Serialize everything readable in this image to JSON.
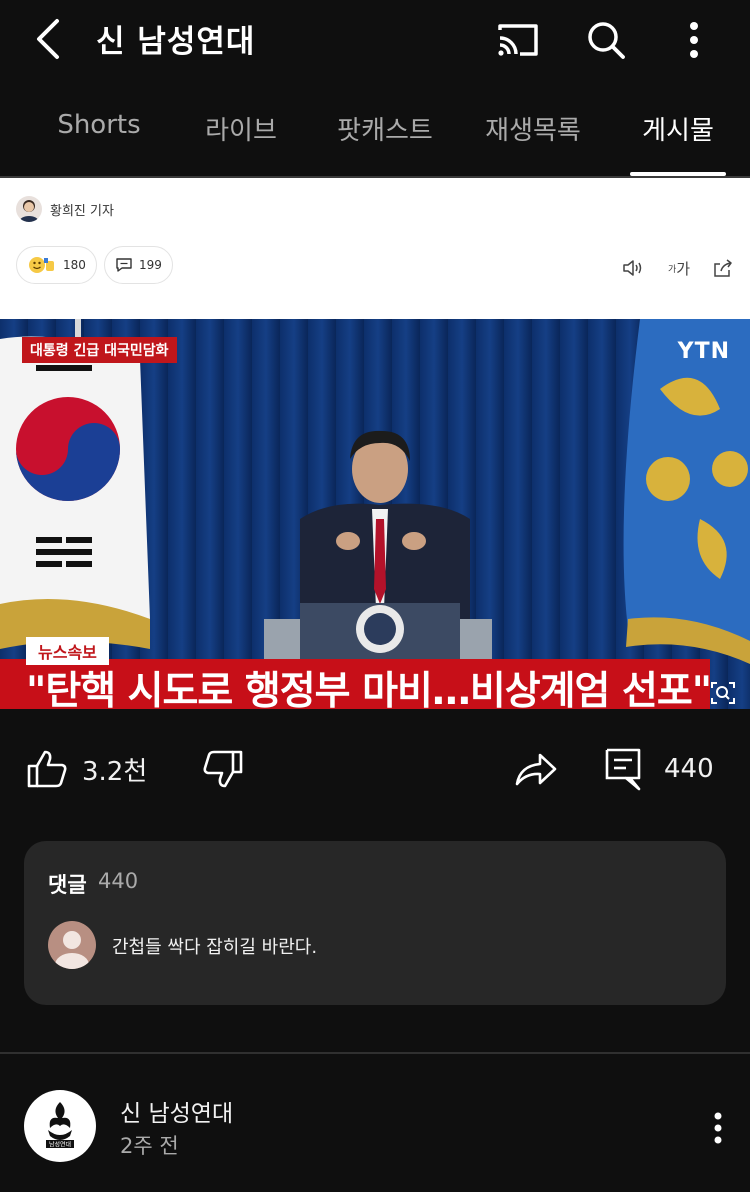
{
  "header": {
    "title": "신 남성연대",
    "back_icon": "chevron-left-icon",
    "cast_icon": "cast-icon",
    "search_icon": "search-icon",
    "menu_icon": "more-vertical-icon"
  },
  "tabs": [
    {
      "label": "Shorts",
      "active": false
    },
    {
      "label": "라이브",
      "active": false
    },
    {
      "label": "팟캐스트",
      "active": false
    },
    {
      "label": "재생목록",
      "active": false
    },
    {
      "label": "게시물",
      "active": true
    }
  ],
  "article": {
    "reporter": "황희진 기자",
    "reactions_count": "180",
    "comments_count": "199",
    "font_size_label": "가"
  },
  "video": {
    "top_caption": "대통령 긴급 대국민담화",
    "broadcaster": "YTN",
    "news_tag": "뉴스속보",
    "headline": "\"탄핵 시도로 행정부 마비…비상계엄 선포\""
  },
  "actions": {
    "likes": "3.2천",
    "comments": "440"
  },
  "comments_section": {
    "title": "댓글",
    "count": "440",
    "top_comment": "간첩들 싹다 잡히길 바란다."
  },
  "channel": {
    "name": "신 남성연대",
    "time_ago": "2주 전",
    "logo_text": "남성연대"
  },
  "colors": {
    "background": "#0f0f0f",
    "card": "#272727",
    "news_red": "#c70f18",
    "muted_text": "#aaaaaa"
  }
}
